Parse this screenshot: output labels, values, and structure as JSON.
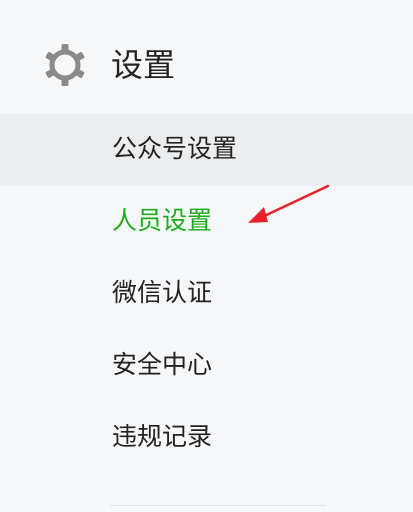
{
  "section": {
    "title": "设置",
    "icon": "gear-icon"
  },
  "menu": {
    "items": [
      {
        "label": "公众号设置",
        "state": "hover"
      },
      {
        "label": "人员设置",
        "state": "active"
      },
      {
        "label": "微信认证",
        "state": "normal"
      },
      {
        "label": "安全中心",
        "state": "normal"
      },
      {
        "label": "违规记录",
        "state": "normal"
      }
    ]
  },
  "annotation": {
    "icon": "red-arrow-icon",
    "color": "#e6212a"
  },
  "colors": {
    "background": "#f6f7f9",
    "hover_background": "#ebedef",
    "active_text": "#1aad19",
    "text": "#222222",
    "icon": "#8a8a8a"
  }
}
